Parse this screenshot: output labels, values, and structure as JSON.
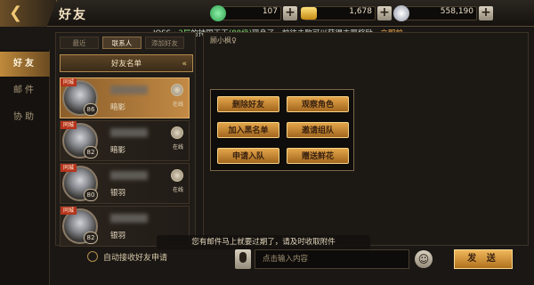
{
  "header": {
    "title": "好友",
    "resources": [
      {
        "icon": "jade-icon",
        "value": "107",
        "color": "#3fc167"
      },
      {
        "icon": "gold-ingot-icon",
        "value": "1,678",
        "color": "#e8b933"
      },
      {
        "icon": "silver-coin-icon",
        "value": "558,190",
        "color": "#c9ccd6"
      }
    ]
  },
  "notice": {
    "prefix": "IOSS・",
    "floor": "2层",
    "mid": "的持国天王",
    "level": "(88级)",
    "tail": "现身了，前往击败可以获得丰厚奖励",
    "link": "立即前"
  },
  "sidenav": [
    {
      "label": "好友"
    },
    {
      "label": "邮件"
    },
    {
      "label": "协助"
    }
  ],
  "tabs": [
    {
      "label": "最近"
    },
    {
      "label": "联系人"
    },
    {
      "label": "添加好友"
    }
  ],
  "list_header": {
    "label": "好友名单",
    "collapse": "«"
  },
  "friends": [
    {
      "name": "暗影",
      "level": "86",
      "tag": "同城",
      "status": "在线"
    },
    {
      "name": "暗影",
      "level": "82",
      "tag": "同城",
      "status": "在线"
    },
    {
      "name": "银羽",
      "level": "80",
      "tag": "同城",
      "status": "在线"
    },
    {
      "name": "银羽",
      "level": "82",
      "tag": "同城",
      "status": ""
    }
  ],
  "auto_accept": {
    "label": "自动接收好友申请"
  },
  "chat": {
    "target_name": "顾小枫♀",
    "actions": [
      {
        "label": "删除好友"
      },
      {
        "label": "观察角色"
      },
      {
        "label": "加入黑名单"
      },
      {
        "label": "邀请组队"
      },
      {
        "label": "申请入队"
      },
      {
        "label": "赠送鲜花"
      }
    ],
    "mail_notice": "您有邮件马上就要过期了，请及时收取附件",
    "input_placeholder": "点击输入内容",
    "send_label": "发 送"
  },
  "colors": {
    "accent": "#e4a64a",
    "selected": "#c28a45",
    "link_green": "#7dd36b"
  }
}
